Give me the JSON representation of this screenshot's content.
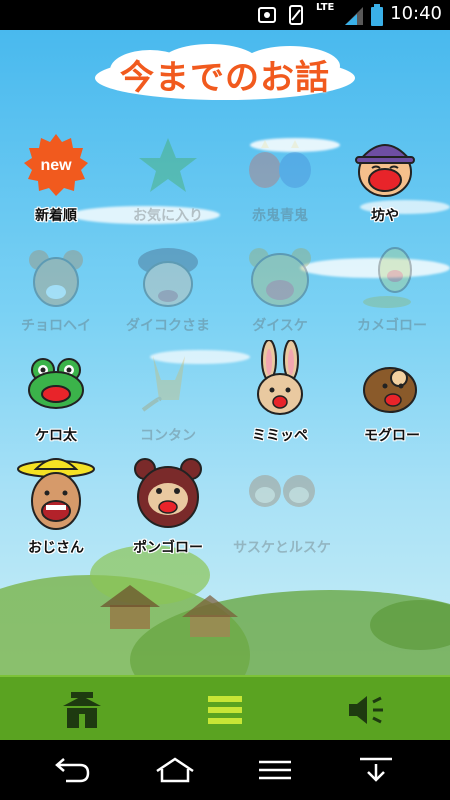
{
  "status_bar": {
    "network": "LTE",
    "time": "10:40"
  },
  "title": "今までのお話",
  "stories": [
    {
      "label": "新着順",
      "icon": "new-badge-icon",
      "badge": "new",
      "enabled": true
    },
    {
      "label": "お気に入り",
      "icon": "star-icon",
      "enabled": false
    },
    {
      "label": "赤鬼青鬼",
      "icon": "red-blue-oni-icon",
      "enabled": false
    },
    {
      "label": "坊や",
      "icon": "boy-character-icon",
      "enabled": true
    },
    {
      "label": "チョロヘイ",
      "icon": "mouse-character-icon",
      "enabled": false
    },
    {
      "label": "ダイコクさま",
      "icon": "daikoku-character-icon",
      "enabled": false
    },
    {
      "label": "ダイスケ",
      "icon": "bear-character-icon",
      "enabled": false
    },
    {
      "label": "カメゴロー",
      "icon": "turtle-character-icon",
      "enabled": false
    },
    {
      "label": "ケロ太",
      "icon": "frog-character-icon",
      "enabled": true
    },
    {
      "label": "コンタン",
      "icon": "fox-character-icon",
      "enabled": false
    },
    {
      "label": "ミミッペ",
      "icon": "rabbit-character-icon",
      "enabled": true
    },
    {
      "label": "モグロー",
      "icon": "mole-character-icon",
      "enabled": true
    },
    {
      "label": "おじさん",
      "icon": "old-man-character-icon",
      "enabled": true
    },
    {
      "label": "ポンゴロー",
      "icon": "tanuki-character-icon",
      "enabled": true
    },
    {
      "label": "サスケとルスケ",
      "icon": "monkeys-character-icon",
      "enabled": false
    }
  ],
  "toolbar": {
    "home_icon": "house-icon",
    "menu_icon": "menu-icon",
    "sound_icon": "speaker-icon"
  },
  "colors": {
    "title": "#f15a1e",
    "toolbar": "#5aa321",
    "menu_accent": "#c8e636"
  }
}
